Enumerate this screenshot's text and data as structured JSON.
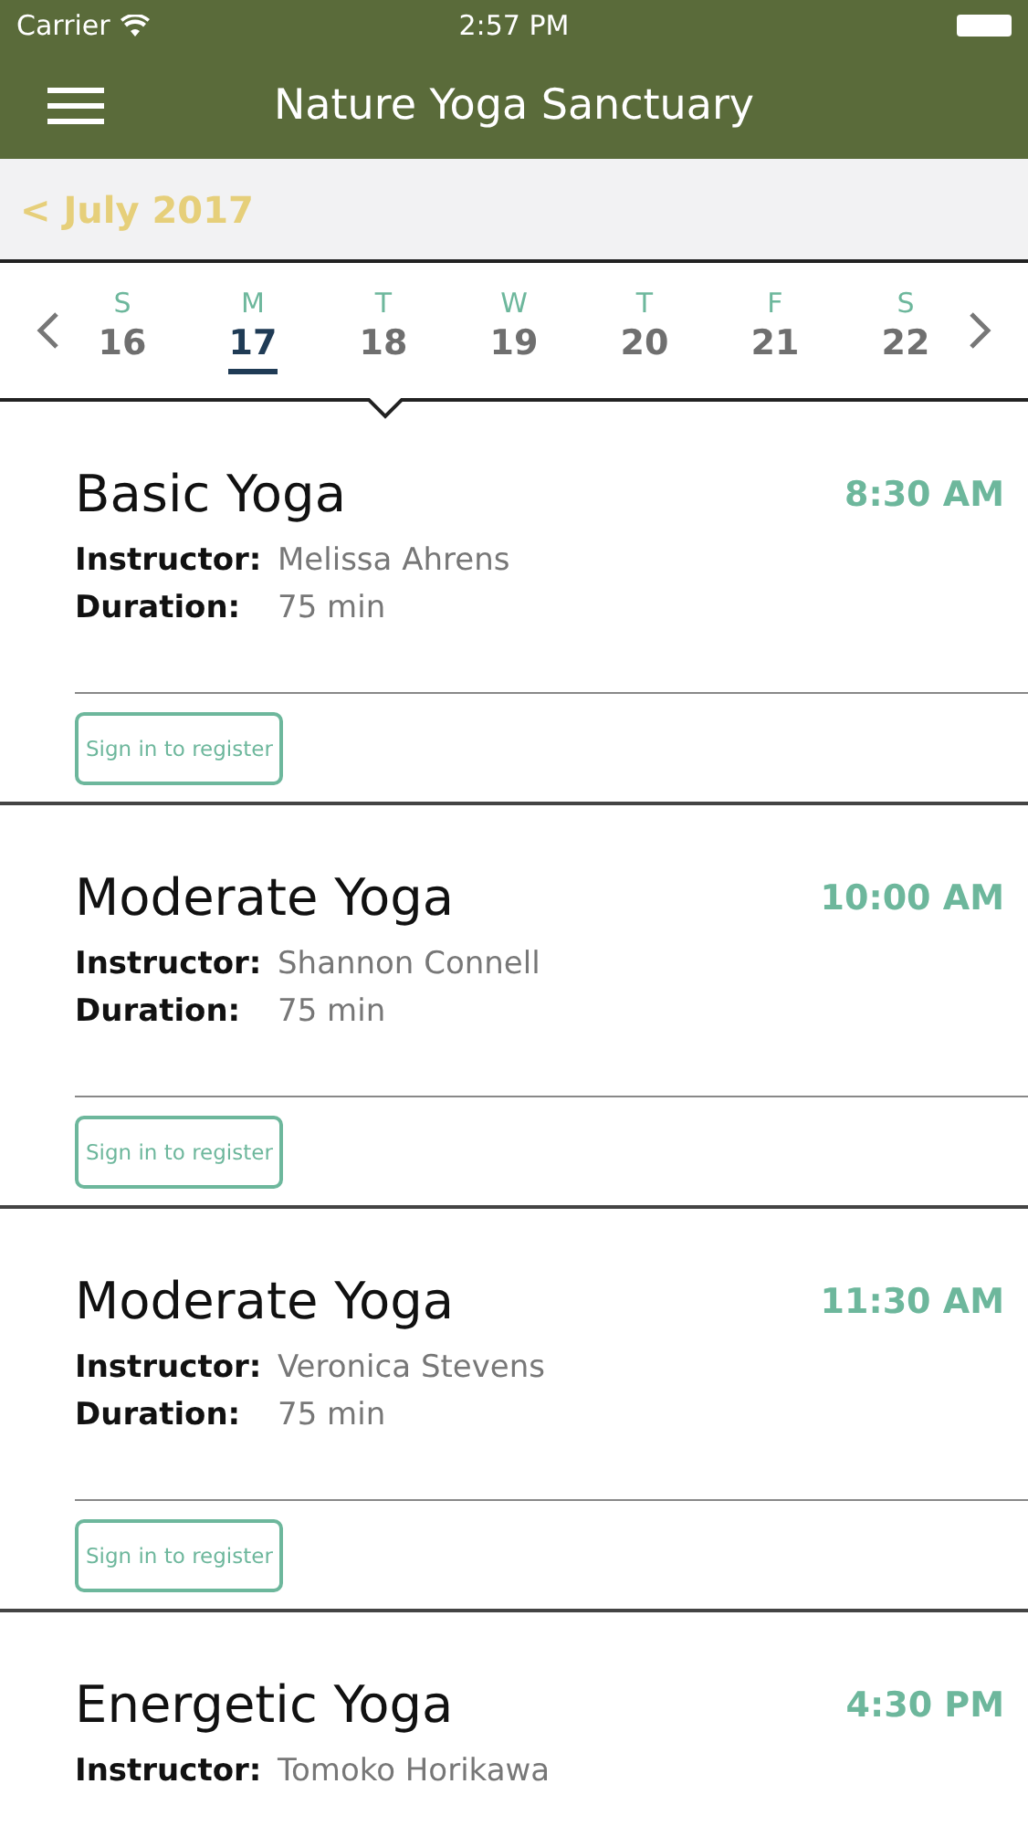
{
  "status_bar": {
    "carrier": "Carrier",
    "time": "2:57 PM"
  },
  "nav": {
    "title": "Nature Yoga Sanctuary"
  },
  "month": {
    "label": "< July 2017"
  },
  "week": {
    "days": [
      {
        "letter": "S",
        "date": "16",
        "selected": false
      },
      {
        "letter": "M",
        "date": "17",
        "selected": true
      },
      {
        "letter": "T",
        "date": "18",
        "selected": false
      },
      {
        "letter": "W",
        "date": "19",
        "selected": false
      },
      {
        "letter": "T",
        "date": "20",
        "selected": false
      },
      {
        "letter": "F",
        "date": "21",
        "selected": false
      },
      {
        "letter": "S",
        "date": "22",
        "selected": false
      }
    ]
  },
  "classes": [
    {
      "title": "Basic Yoga",
      "time": "8:30 AM",
      "details": [
        {
          "label": "Instructor:",
          "value": "Melissa Ahrens"
        },
        {
          "label": "Duration:",
          "value": "75 min"
        }
      ],
      "button": "Sign in to register"
    },
    {
      "title": "Moderate Yoga",
      "time": "10:00 AM",
      "details": [
        {
          "label": "Instructor:",
          "value": "Shannon Connell"
        },
        {
          "label": "Duration:",
          "value": "75 min"
        }
      ],
      "button": "Sign in to register"
    },
    {
      "title": "Moderate Yoga",
      "time": "11:30 AM",
      "details": [
        {
          "label": "Instructor:",
          "value": "Veronica Stevens"
        },
        {
          "label": "Duration:",
          "value": "75 min"
        }
      ],
      "button": "Sign in to register"
    },
    {
      "title": "Energetic Yoga",
      "time": "4:30 PM",
      "details": [
        {
          "label": "Instructor:",
          "value": "Tomoko Horikawa"
        }
      ]
    }
  ]
}
